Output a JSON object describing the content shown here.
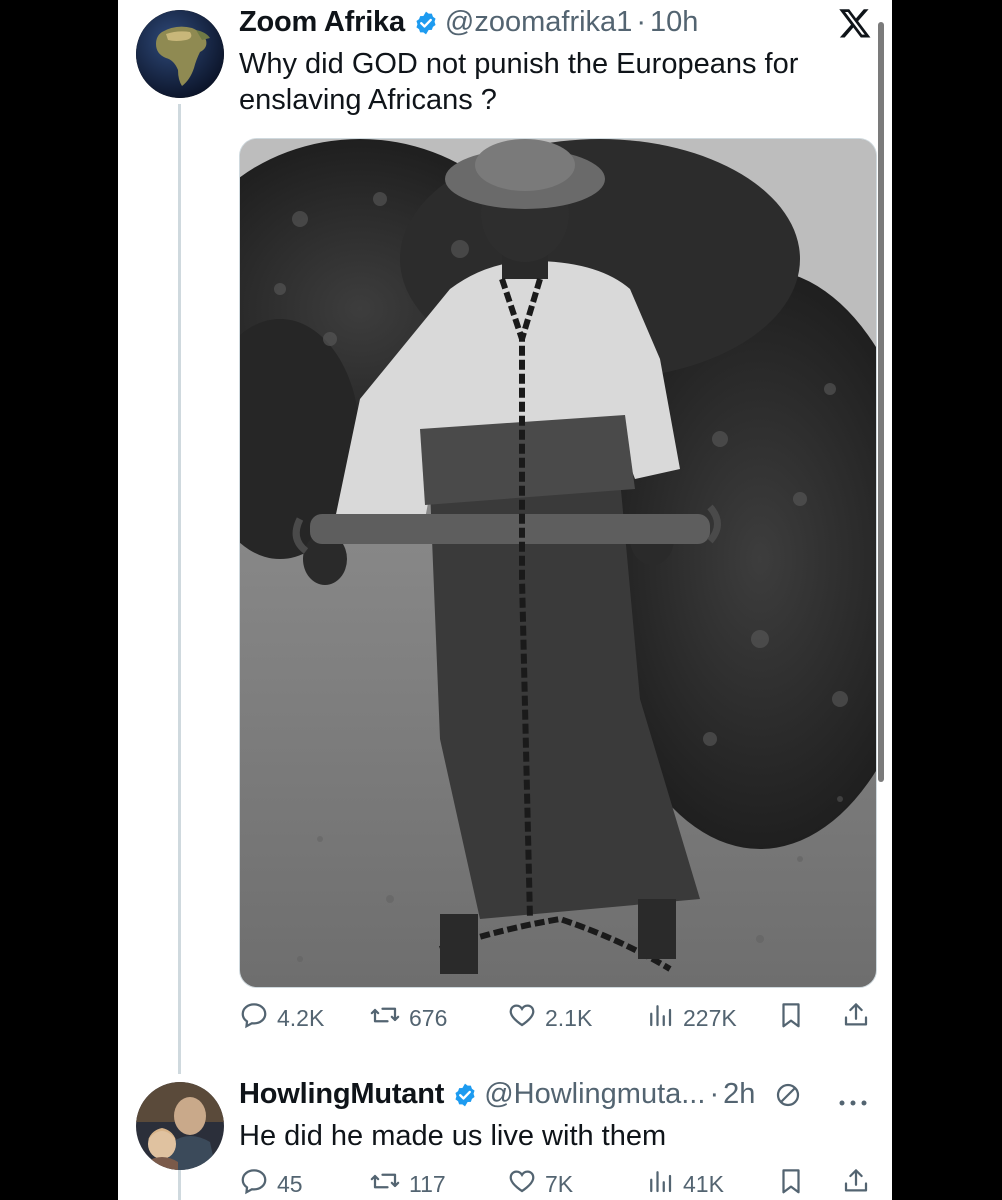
{
  "tweet": {
    "name": "Zoom Afrika",
    "handle": "@zoomafrika1",
    "sep": "·",
    "time": "10h",
    "text": "Why did GOD not punish the Europeans for enslaving Africans ?",
    "actions": {
      "replies": "4.2K",
      "reposts": "676",
      "likes": "2.1K",
      "views": "227K"
    }
  },
  "reply": {
    "name": "HowlingMutant",
    "handle": "@Howlingmuta...",
    "sep": "·",
    "time": "2h",
    "text": "He did he made us live with them",
    "actions": {
      "replies": "45",
      "reposts": "117",
      "likes": "7K",
      "views": "41K"
    }
  },
  "colors": {
    "verified": "#1d9bf0",
    "muted": "#536471",
    "thread_line": "#cfd9de"
  },
  "icons": [
    "x-logo-icon",
    "verified-badge-icon",
    "reply-icon",
    "repost-icon",
    "like-icon",
    "views-icon",
    "bookmark-icon",
    "share-icon",
    "no-entry-icon",
    "more-icon"
  ]
}
